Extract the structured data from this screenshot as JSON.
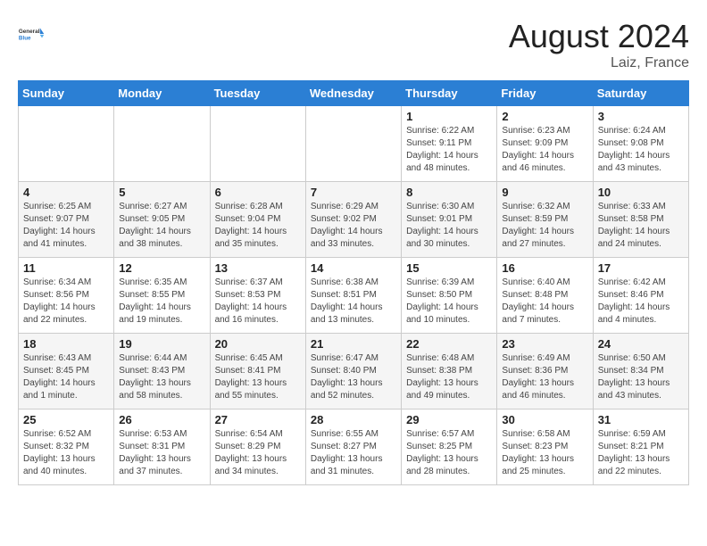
{
  "logo": {
    "line1": "General",
    "line2": "Blue"
  },
  "title": "August 2024",
  "location": "Laiz, France",
  "days_of_week": [
    "Sunday",
    "Monday",
    "Tuesday",
    "Wednesday",
    "Thursday",
    "Friday",
    "Saturday"
  ],
  "weeks": [
    [
      {
        "day": "",
        "info": ""
      },
      {
        "day": "",
        "info": ""
      },
      {
        "day": "",
        "info": ""
      },
      {
        "day": "",
        "info": ""
      },
      {
        "day": "1",
        "info": "Sunrise: 6:22 AM\nSunset: 9:11 PM\nDaylight: 14 hours and 48 minutes."
      },
      {
        "day": "2",
        "info": "Sunrise: 6:23 AM\nSunset: 9:09 PM\nDaylight: 14 hours and 46 minutes."
      },
      {
        "day": "3",
        "info": "Sunrise: 6:24 AM\nSunset: 9:08 PM\nDaylight: 14 hours and 43 minutes."
      }
    ],
    [
      {
        "day": "4",
        "info": "Sunrise: 6:25 AM\nSunset: 9:07 PM\nDaylight: 14 hours and 41 minutes."
      },
      {
        "day": "5",
        "info": "Sunrise: 6:27 AM\nSunset: 9:05 PM\nDaylight: 14 hours and 38 minutes."
      },
      {
        "day": "6",
        "info": "Sunrise: 6:28 AM\nSunset: 9:04 PM\nDaylight: 14 hours and 35 minutes."
      },
      {
        "day": "7",
        "info": "Sunrise: 6:29 AM\nSunset: 9:02 PM\nDaylight: 14 hours and 33 minutes."
      },
      {
        "day": "8",
        "info": "Sunrise: 6:30 AM\nSunset: 9:01 PM\nDaylight: 14 hours and 30 minutes."
      },
      {
        "day": "9",
        "info": "Sunrise: 6:32 AM\nSunset: 8:59 PM\nDaylight: 14 hours and 27 minutes."
      },
      {
        "day": "10",
        "info": "Sunrise: 6:33 AM\nSunset: 8:58 PM\nDaylight: 14 hours and 24 minutes."
      }
    ],
    [
      {
        "day": "11",
        "info": "Sunrise: 6:34 AM\nSunset: 8:56 PM\nDaylight: 14 hours and 22 minutes."
      },
      {
        "day": "12",
        "info": "Sunrise: 6:35 AM\nSunset: 8:55 PM\nDaylight: 14 hours and 19 minutes."
      },
      {
        "day": "13",
        "info": "Sunrise: 6:37 AM\nSunset: 8:53 PM\nDaylight: 14 hours and 16 minutes."
      },
      {
        "day": "14",
        "info": "Sunrise: 6:38 AM\nSunset: 8:51 PM\nDaylight: 14 hours and 13 minutes."
      },
      {
        "day": "15",
        "info": "Sunrise: 6:39 AM\nSunset: 8:50 PM\nDaylight: 14 hours and 10 minutes."
      },
      {
        "day": "16",
        "info": "Sunrise: 6:40 AM\nSunset: 8:48 PM\nDaylight: 14 hours and 7 minutes."
      },
      {
        "day": "17",
        "info": "Sunrise: 6:42 AM\nSunset: 8:46 PM\nDaylight: 14 hours and 4 minutes."
      }
    ],
    [
      {
        "day": "18",
        "info": "Sunrise: 6:43 AM\nSunset: 8:45 PM\nDaylight: 14 hours and 1 minute."
      },
      {
        "day": "19",
        "info": "Sunrise: 6:44 AM\nSunset: 8:43 PM\nDaylight: 13 hours and 58 minutes."
      },
      {
        "day": "20",
        "info": "Sunrise: 6:45 AM\nSunset: 8:41 PM\nDaylight: 13 hours and 55 minutes."
      },
      {
        "day": "21",
        "info": "Sunrise: 6:47 AM\nSunset: 8:40 PM\nDaylight: 13 hours and 52 minutes."
      },
      {
        "day": "22",
        "info": "Sunrise: 6:48 AM\nSunset: 8:38 PM\nDaylight: 13 hours and 49 minutes."
      },
      {
        "day": "23",
        "info": "Sunrise: 6:49 AM\nSunset: 8:36 PM\nDaylight: 13 hours and 46 minutes."
      },
      {
        "day": "24",
        "info": "Sunrise: 6:50 AM\nSunset: 8:34 PM\nDaylight: 13 hours and 43 minutes."
      }
    ],
    [
      {
        "day": "25",
        "info": "Sunrise: 6:52 AM\nSunset: 8:32 PM\nDaylight: 13 hours and 40 minutes."
      },
      {
        "day": "26",
        "info": "Sunrise: 6:53 AM\nSunset: 8:31 PM\nDaylight: 13 hours and 37 minutes."
      },
      {
        "day": "27",
        "info": "Sunrise: 6:54 AM\nSunset: 8:29 PM\nDaylight: 13 hours and 34 minutes."
      },
      {
        "day": "28",
        "info": "Sunrise: 6:55 AM\nSunset: 8:27 PM\nDaylight: 13 hours and 31 minutes."
      },
      {
        "day": "29",
        "info": "Sunrise: 6:57 AM\nSunset: 8:25 PM\nDaylight: 13 hours and 28 minutes."
      },
      {
        "day": "30",
        "info": "Sunrise: 6:58 AM\nSunset: 8:23 PM\nDaylight: 13 hours and 25 minutes."
      },
      {
        "day": "31",
        "info": "Sunrise: 6:59 AM\nSunset: 8:21 PM\nDaylight: 13 hours and 22 minutes."
      }
    ]
  ]
}
